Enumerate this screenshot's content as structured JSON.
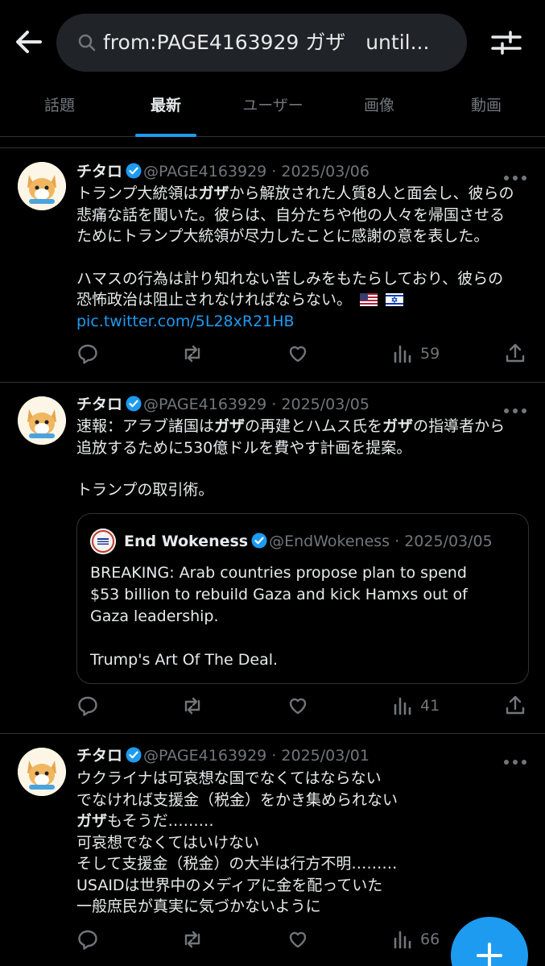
{
  "search": {
    "query": "from:PAGE4163929 ガザ　until..."
  },
  "tabs": [
    {
      "label": "話題"
    },
    {
      "label": "最新"
    },
    {
      "label": "ユーザー"
    },
    {
      "label": "画像"
    },
    {
      "label": "動画"
    }
  ],
  "active_tab": "最新",
  "accent_color": "#1d9bf0",
  "tweets": [
    {
      "name": "チタロ",
      "handle": "@PAGE4163929",
      "sep": "·",
      "date": "2025/03/06",
      "lines": {
        "l1a": "トランプ大統領は",
        "l1b": "ガザ",
        "l1c": "から解放された人質8人と面会し、彼らの",
        "l2": "悲痛な話を聞いた。彼らは、自分たちや他の人々を帰国させる",
        "l3": "ためにトランプ大統領が尽力したことに感謝の意を表した。",
        "l4": "ハマスの行為は計り知れない苦しみをもたらしており、彼らの",
        "l5": "恐怖政治は阻止されなければならない。"
      },
      "flags": [
        "us-flag-icon",
        "israel-flag-icon"
      ],
      "link": "pic.twitter.com/5L28xR21HB",
      "views": "59"
    },
    {
      "name": "チタロ",
      "handle": "@PAGE4163929",
      "sep": "·",
      "date": "2025/03/05",
      "lines": {
        "l1a": "速報：アラブ諸国は",
        "l1b": "ガザ",
        "l1c": "の再建とハムス氏を",
        "l1d": "ガザ",
        "l1e": "の指導者から",
        "l2": "追放するために530億ドルを費やす計画を提案。",
        "l3": "トランプの取引術。"
      },
      "quote": {
        "name": "End Wokeness",
        "handle": "@EndWokeness",
        "sep": "·",
        "date": "2025/03/05",
        "l1": "BREAKING: Arab countries propose plan to spend",
        "l2": "$53 billion to rebuild Gaza and kick Hamxs out of",
        "l3": "Gaza leadership.",
        "l4": "Trump's Art Of The Deal."
      },
      "views": "41"
    },
    {
      "name": "チタロ",
      "handle": "@PAGE4163929",
      "sep": "·",
      "date": "2025/03/01",
      "lines": {
        "l1": "ウクライナは可哀想な国でなくてはならない",
        "l2": "でなければ支援金（税金）をかき集められない",
        "l3a": "ガザ",
        "l3b": "もそうだ………",
        "l4": "可哀想でなくてはいけない",
        "l5": "そして支援金（税金）の大半は行方不明………",
        "l6": "USAIDは世界中のメディアに金を配っていた",
        "l7": "一般庶民が真実に気づかないように"
      },
      "views": "66"
    }
  ]
}
